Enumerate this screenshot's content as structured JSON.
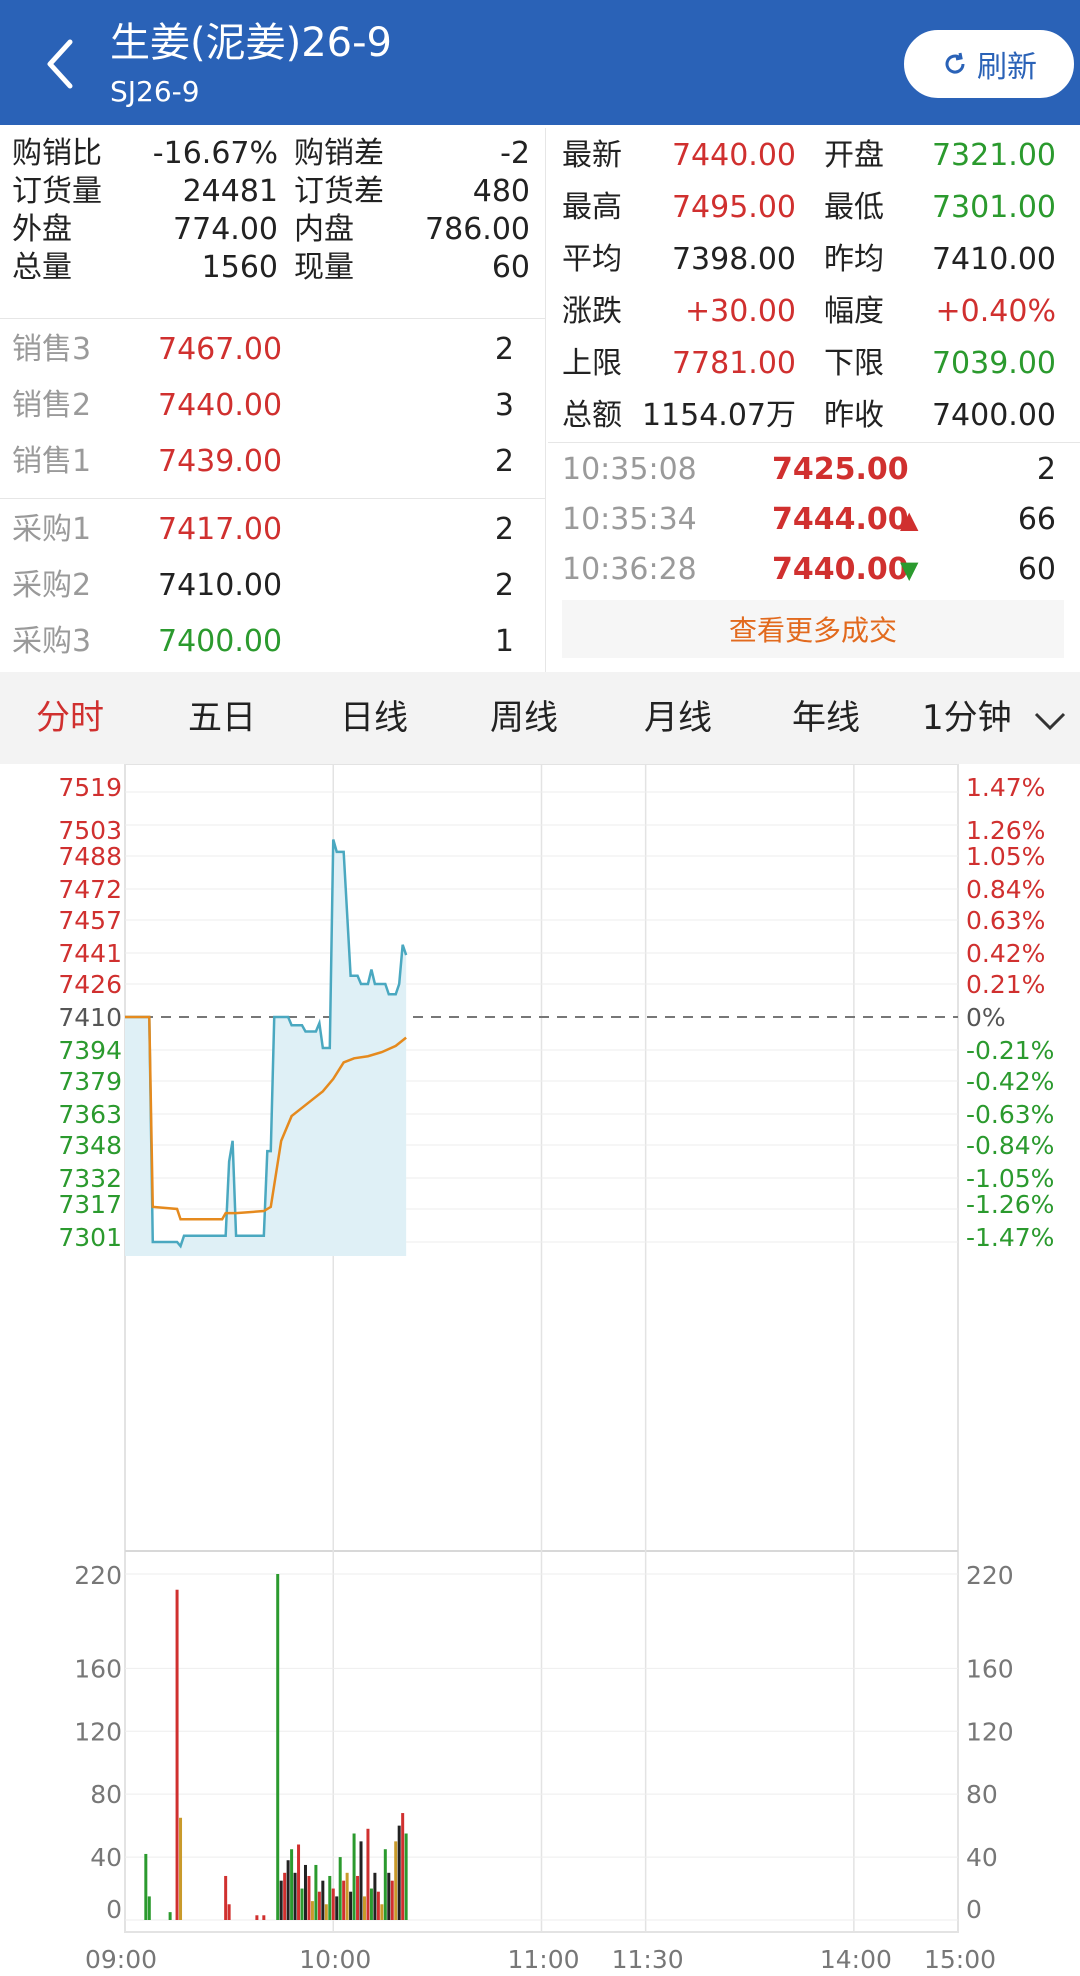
{
  "header": {
    "title": "生姜(泥姜)26-9",
    "subtitle": "SJ26-9",
    "refresh_label": "刷新"
  },
  "left_stats": [
    {
      "l1": "购销比",
      "v1": "-16.67%",
      "l2": "购销差",
      "v2": "-2"
    },
    {
      "l1": "订货量",
      "v1": "24481",
      "l2": "订货差",
      "v2": "480"
    },
    {
      "l1": "外盘",
      "v1": "774.00",
      "l2": "内盘",
      "v2": "786.00"
    },
    {
      "l1": "总量",
      "v1": "1560",
      "l2": "现量",
      "v2": "60"
    }
  ],
  "sell_book": [
    {
      "label": "销售3",
      "price": "7467.00",
      "qty": "2",
      "color": "red"
    },
    {
      "label": "销售2",
      "price": "7440.00",
      "qty": "3",
      "color": "red"
    },
    {
      "label": "销售1",
      "price": "7439.00",
      "qty": "2",
      "color": "red"
    }
  ],
  "buy_book": [
    {
      "label": "采购1",
      "price": "7417.00",
      "qty": "2",
      "color": "red"
    },
    {
      "label": "采购2",
      "price": "7410.00",
      "qty": "2",
      "color": "black"
    },
    {
      "label": "采购3",
      "price": "7400.00",
      "qty": "1",
      "color": "green"
    }
  ],
  "right_stats": [
    {
      "l1": "最新",
      "v1": "7440.00",
      "c1": "red",
      "l2": "开盘",
      "v2": "7321.00",
      "c2": "green"
    },
    {
      "l1": "最高",
      "v1": "7495.00",
      "c1": "red",
      "l2": "最低",
      "v2": "7301.00",
      "c2": "green"
    },
    {
      "l1": "平均",
      "v1": "7398.00",
      "c1": "black",
      "l2": "昨均",
      "v2": "7410.00",
      "c2": "black"
    },
    {
      "l1": "涨跌",
      "v1": "+30.00",
      "c1": "red",
      "l2": "幅度",
      "v2": "+0.40%",
      "c2": "red"
    },
    {
      "l1": "上限",
      "v1": "7781.00",
      "c1": "red",
      "l2": "下限",
      "v2": "7039.00",
      "c2": "green"
    },
    {
      "l1": "总额",
      "v1": "1154.07万",
      "c1": "black",
      "l2": "昨收",
      "v2": "7400.00",
      "c2": "black"
    }
  ],
  "trades": [
    {
      "time": "10:35:08",
      "price": "7425.00",
      "arrow": "",
      "qty": "2"
    },
    {
      "time": "10:35:34",
      "price": "7444.00",
      "arrow": "▲",
      "qty": "66"
    },
    {
      "time": "10:36:28",
      "price": "7440.00",
      "arrow": "▼",
      "qty": "60"
    }
  ],
  "more_trades_label": "查看更多成交",
  "tabs": [
    {
      "label": "分时",
      "active": true
    },
    {
      "label": "五日",
      "active": false
    },
    {
      "label": "日线",
      "active": false
    },
    {
      "label": "周线",
      "active": false
    },
    {
      "label": "月线",
      "active": false
    },
    {
      "label": "年线",
      "active": false
    }
  ],
  "interval_select": "1分钟",
  "colors": {
    "header": "#2a62b7",
    "up": "#d0302f",
    "down": "#2b9a2e",
    "price_line": "#4aa8c0",
    "avg_line": "#e58a1e",
    "orange_link": "#e26a1e"
  },
  "chart_data": [
    {
      "type": "line",
      "y_left_ticks": [
        "7519",
        "7503",
        "7488",
        "7472",
        "7457",
        "7441",
        "7426",
        "7410",
        "7394",
        "7379",
        "7363",
        "7348",
        "7332",
        "7317",
        "7301"
      ],
      "y_right_ticks": [
        "1.47%",
        "1.26%",
        "1.05%",
        "0.84%",
        "0.63%",
        "0.42%",
        "0.21%",
        "0%",
        "-0.21%",
        "-0.42%",
        "-0.63%",
        "-0.84%",
        "-1.05%",
        "-1.26%",
        "-1.47%"
      ],
      "x_ticks": [
        "09:00",
        "10:00",
        "11:00",
        "11:30",
        "14:00",
        "15:00"
      ],
      "ylim": [
        7301,
        7519
      ],
      "baseline": 7410,
      "x_minutes_total": 240,
      "series": [
        {
          "points": [
            [
              0,
              7410
            ],
            [
              7,
              7410
            ],
            [
              8,
              7301
            ],
            [
              15,
              7301
            ],
            [
              16,
              7299
            ],
            [
              17,
              7304
            ],
            [
              29,
              7304
            ],
            [
              30,
              7340
            ],
            [
              31,
              7350
            ],
            [
              32,
              7304
            ],
            [
              40,
              7304
            ],
            [
              41,
              7345
            ],
            [
              42,
              7345
            ],
            [
              43,
              7410
            ],
            [
              47,
              7410
            ],
            [
              48,
              7406
            ],
            [
              51,
              7406
            ],
            [
              52,
              7403
            ],
            [
              55,
              7403
            ],
            [
              56,
              7407
            ],
            [
              57,
              7395
            ],
            [
              59,
              7395
            ],
            [
              60,
              7496
            ],
            [
              61,
              7490
            ],
            [
              63,
              7490
            ],
            [
              64,
              7460
            ],
            [
              65,
              7430
            ],
            [
              67,
              7430
            ],
            [
              68,
              7426
            ],
            [
              70,
              7426
            ],
            [
              71,
              7433
            ],
            [
              72,
              7426
            ],
            [
              75,
              7426
            ],
            [
              76,
              7421
            ],
            [
              78,
              7421
            ],
            [
              79,
              7426
            ],
            [
              80,
              7445
            ],
            [
              81,
              7440
            ]
          ]
        },
        {
          "points": [
            [
              0,
              7410
            ],
            [
              7,
              7410
            ],
            [
              8,
              7318
            ],
            [
              15,
              7317
            ],
            [
              16,
              7312
            ],
            [
              28,
              7312
            ],
            [
              29,
              7315
            ],
            [
              32,
              7315
            ],
            [
              40,
              7316
            ],
            [
              42,
              7318
            ],
            [
              45,
              7350
            ],
            [
              48,
              7362
            ],
            [
              51,
              7366
            ],
            [
              54,
              7370
            ],
            [
              57,
              7374
            ],
            [
              60,
              7380
            ],
            [
              63,
              7388
            ],
            [
              66,
              7390
            ],
            [
              70,
              7391
            ],
            [
              74,
              7393
            ],
            [
              78,
              7396
            ],
            [
              81,
              7400
            ]
          ]
        }
      ]
    },
    {
      "type": "bar",
      "ylim": [
        0,
        220
      ],
      "y_ticks": [
        "220",
        "160",
        "120",
        "80",
        "40",
        "0"
      ],
      "bars": [
        {
          "m": 6,
          "v": 42,
          "c": "g"
        },
        {
          "m": 7,
          "v": 15,
          "c": "g"
        },
        {
          "m": 13,
          "v": 5,
          "c": "g"
        },
        {
          "m": 15,
          "v": 210,
          "c": "r"
        },
        {
          "m": 16,
          "v": 65,
          "c": "y"
        },
        {
          "m": 29,
          "v": 28,
          "c": "r"
        },
        {
          "m": 30,
          "v": 10,
          "c": "r"
        },
        {
          "m": 38,
          "v": 3,
          "c": "r"
        },
        {
          "m": 40,
          "v": 3,
          "c": "r"
        },
        {
          "m": 44,
          "v": 220,
          "c": "g"
        },
        {
          "m": 45,
          "v": 25,
          "c": "k"
        },
        {
          "m": 46,
          "v": 30,
          "c": "r"
        },
        {
          "m": 47,
          "v": 38,
          "c": "k"
        },
        {
          "m": 48,
          "v": 45,
          "c": "g"
        },
        {
          "m": 49,
          "v": 30,
          "c": "k"
        },
        {
          "m": 50,
          "v": 48,
          "c": "r"
        },
        {
          "m": 51,
          "v": 20,
          "c": "g"
        },
        {
          "m": 52,
          "v": 35,
          "c": "k"
        },
        {
          "m": 53,
          "v": 28,
          "c": "r"
        },
        {
          "m": 54,
          "v": 12,
          "c": "y"
        },
        {
          "m": 55,
          "v": 35,
          "c": "g"
        },
        {
          "m": 56,
          "v": 18,
          "c": "r"
        },
        {
          "m": 57,
          "v": 25,
          "c": "k"
        },
        {
          "m": 58,
          "v": 10,
          "c": "y"
        },
        {
          "m": 59,
          "v": 28,
          "c": "g"
        },
        {
          "m": 60,
          "v": 20,
          "c": "r"
        },
        {
          "m": 61,
          "v": 15,
          "c": "k"
        },
        {
          "m": 62,
          "v": 40,
          "c": "g"
        },
        {
          "m": 63,
          "v": 25,
          "c": "r"
        },
        {
          "m": 64,
          "v": 30,
          "c": "y"
        },
        {
          "m": 65,
          "v": 18,
          "c": "k"
        },
        {
          "m": 66,
          "v": 55,
          "c": "g"
        },
        {
          "m": 67,
          "v": 28,
          "c": "r"
        },
        {
          "m": 68,
          "v": 50,
          "c": "k"
        },
        {
          "m": 69,
          "v": 15,
          "c": "y"
        },
        {
          "m": 70,
          "v": 58,
          "c": "r"
        },
        {
          "m": 71,
          "v": 20,
          "c": "g"
        },
        {
          "m": 72,
          "v": 30,
          "c": "k"
        },
        {
          "m": 73,
          "v": 18,
          "c": "r"
        },
        {
          "m": 74,
          "v": 10,
          "c": "y"
        },
        {
          "m": 75,
          "v": 45,
          "c": "g"
        },
        {
          "m": 76,
          "v": 30,
          "c": "k"
        },
        {
          "m": 77,
          "v": 25,
          "c": "r"
        },
        {
          "m": 78,
          "v": 50,
          "c": "y"
        },
        {
          "m": 79,
          "v": 60,
          "c": "k"
        },
        {
          "m": 80,
          "v": 68,
          "c": "r"
        },
        {
          "m": 81,
          "v": 55,
          "c": "g"
        }
      ]
    }
  ]
}
